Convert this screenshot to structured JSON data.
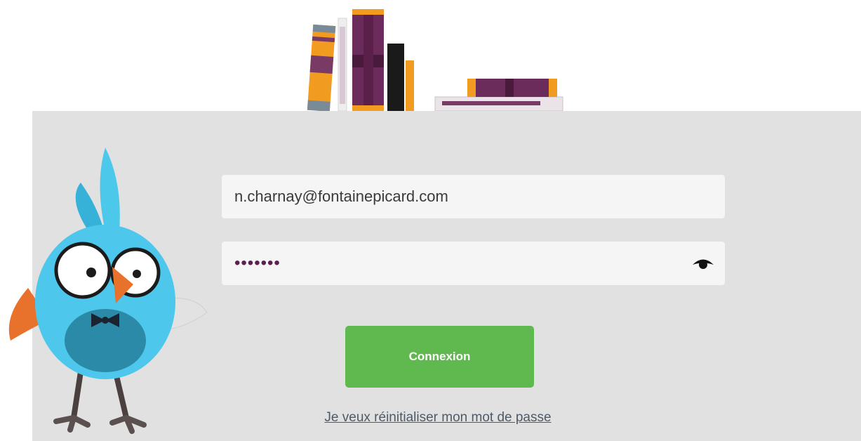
{
  "login": {
    "email_value": "n.charnay@fontainepicard.com",
    "password_value": "•••••••",
    "show_password_icon": "eye-icon",
    "submit_label": "Connexion",
    "reset_link_label": "Je veux réinitialiser mon mot de passe"
  },
  "colors": {
    "panel": "#e1e1e1",
    "field": "#f5f5f5",
    "button": "#5fb94f",
    "password_dots": "#5b2050"
  }
}
